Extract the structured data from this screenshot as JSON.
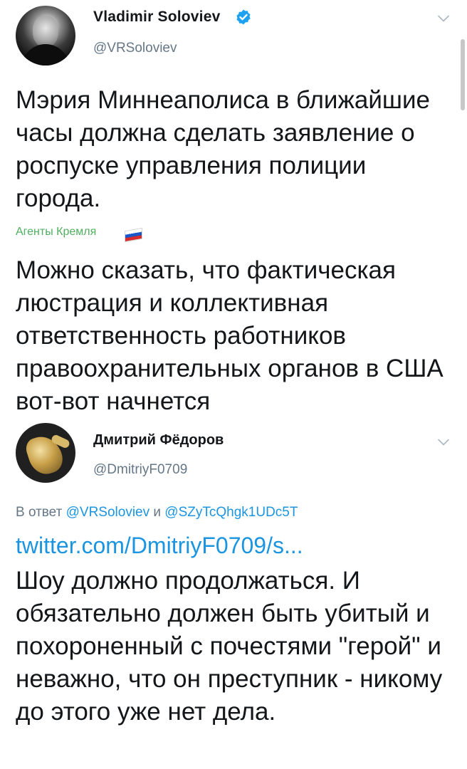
{
  "tweet1": {
    "author": {
      "name": "Vladimir Soloviev",
      "handle": "@VRSoloviev",
      "verified": true
    },
    "text": "Мэрия Миннеаполиса в ближайшие часы должна сделать заявление о роспуске управления полиции города."
  },
  "repost": {
    "channel": "Агенты Кремля",
    "flag_icon": "russian-flag-icon",
    "comment": "Можно сказать, что фактическая люстрация и коллективная ответственность работников правоохранительных органов в США вот-вот начнется"
  },
  "tweet2": {
    "author": {
      "name": "Дмитрий Фёдоров",
      "handle": "@DmitriyF0709"
    },
    "reply": {
      "prefix": "В ответ",
      "mention1": "@VRSoloviev",
      "conjunction": "и",
      "mention2": "@SZyTcQhgk1UDc5T"
    },
    "link": "twitter.com/DmitriyF0709/s...",
    "text": "Шоу должно продолжаться. И обязательно должен быть убитый и похороненный с почестями \"герой\" и неважно, что он преступник - никому до этого уже нет дела."
  },
  "colors": {
    "text": "#14171a",
    "secondary": "#657786",
    "link": "#1b95e0",
    "channel": "#4fae5f",
    "verified": "#1da1f2"
  }
}
